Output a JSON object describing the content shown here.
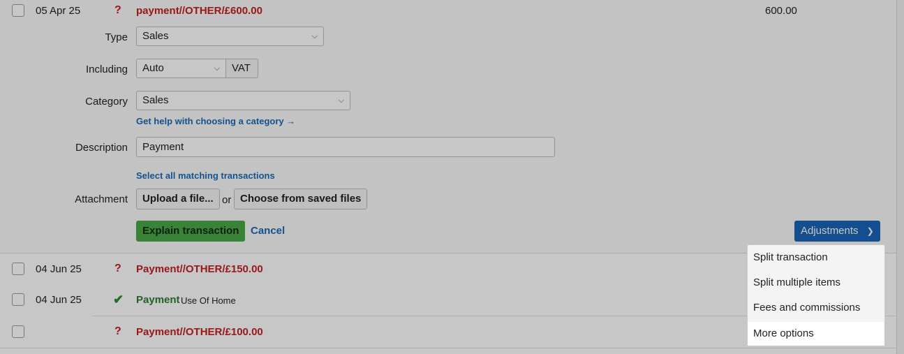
{
  "expanded_row": {
    "date": "05 Apr 25",
    "status": "?",
    "description": "payment//OTHER/£600.00",
    "amount": "600.00",
    "form": {
      "type_label": "Type",
      "type_value": "Sales",
      "including_label": "Including",
      "including_value": "Auto",
      "vat_label": "VAT",
      "category_label": "Category",
      "category_value": "Sales",
      "category_help": "Get help with choosing a category →",
      "description_label": "Description",
      "description_value": "Payment",
      "select_matching": "Select all matching transactions",
      "attachment_label": "Attachment",
      "upload_button": "Upload a file...",
      "or_text": "or",
      "choose_saved_button": "Choose from saved files",
      "explain_button": "Explain transaction",
      "cancel_link": "Cancel",
      "adjustments_button": "Adjustments"
    }
  },
  "rows": [
    {
      "date": "04 Jun 25",
      "status": "?",
      "description": "Payment//OTHER/£150.00"
    },
    {
      "date": "04 Jun 25",
      "status": "✔",
      "description": "Payment",
      "sub": "Use Of Home"
    },
    {
      "date": "",
      "status": "?",
      "description": "Payment//OTHER/£100.00"
    }
  ],
  "adjustments_menu": {
    "items": [
      "Split transaction",
      "Split multiple items",
      "Fees and commissions",
      "More options"
    ],
    "highlighted_index": 3
  },
  "colors": {
    "unexplained": "#c22020",
    "explained": "#2e7d32",
    "link": "#1a6bb5",
    "primary_green": "#4aa84a",
    "adjustments_blue": "#1c64b8"
  }
}
